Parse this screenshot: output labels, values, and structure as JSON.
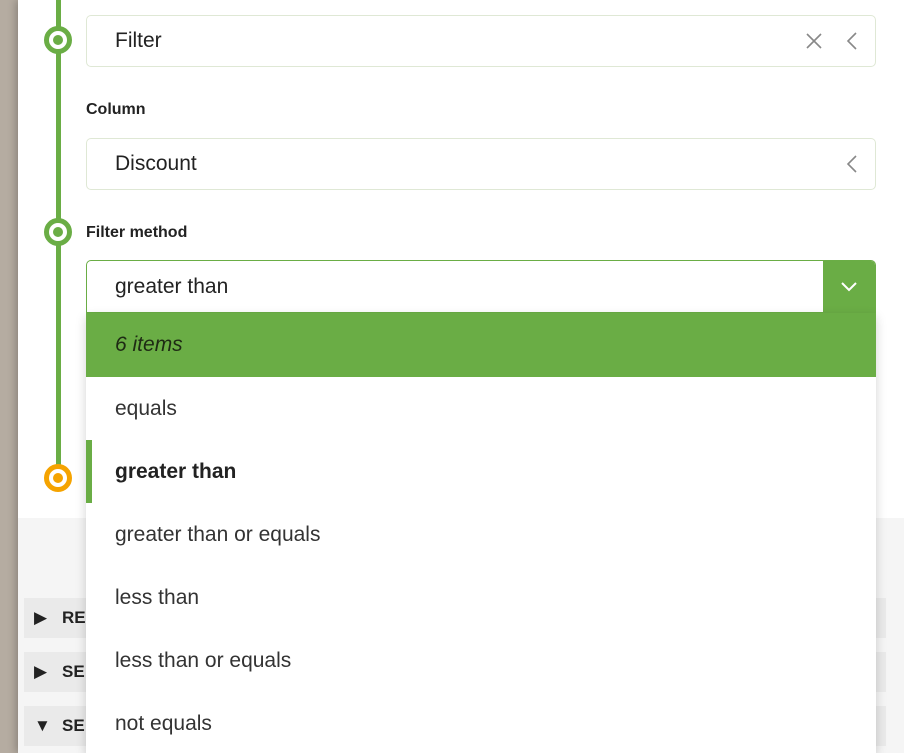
{
  "steps": {
    "filter_field": {
      "value": "Filter"
    },
    "column": {
      "label": "Column",
      "value": "Discount"
    },
    "filter_method": {
      "label": "Filter method",
      "selected_value": "greater than",
      "dropdown": {
        "count_text": "6 items",
        "options": [
          {
            "label": "equals",
            "selected": false
          },
          {
            "label": "greater than",
            "selected": true
          },
          {
            "label": "greater than or equals",
            "selected": false
          },
          {
            "label": "less than",
            "selected": false
          },
          {
            "label": "less than or equals",
            "selected": false
          },
          {
            "label": "not equals",
            "selected": false
          }
        ]
      }
    }
  },
  "accordion": {
    "items": [
      {
        "label_visible": "RE",
        "arrow": "triangle-right-icon"
      },
      {
        "label_visible": "SE",
        "arrow": "triangle-right-icon"
      },
      {
        "label_visible": "SE",
        "arrow": "triangle-down-icon"
      }
    ]
  },
  "colors": {
    "accent_green": "#6aad45",
    "pending_orange": "#f5a300"
  }
}
